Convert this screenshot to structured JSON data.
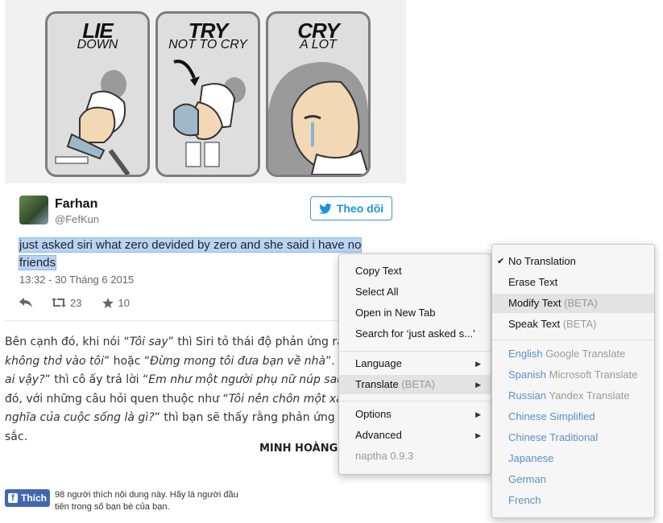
{
  "comic": {
    "panels": [
      {
        "line1": "LIE",
        "line2": "DOWN"
      },
      {
        "line1": "TRY",
        "line2": "NOT TO CRY"
      },
      {
        "line1": "CRY",
        "line2": "A LOT"
      }
    ]
  },
  "tweet": {
    "name": "Farhan",
    "handle": "@FefKun",
    "follow_label": "Theo dõi",
    "text": "just asked siri what zero devided by zero and she said i have no friends",
    "timestamp": "13:32 - 30 Tháng 6 2015",
    "retweets": "23",
    "likes": "10"
  },
  "article": {
    "lines": [
      [
        "Bên cạnh đó, khi nói “",
        "Tôi say",
        "” thì Siri tỏ thái độ phản ứng rất qu"
      ],
      [
        "",
        "không thở vào tôi",
        "” hoặc “",
        "Đừng mong tôi đưa bạn về nhà",
        "”. Đặc l"
      ],
      [
        "",
        "ai vậy?",
        "” thì cô ấy trả lời “",
        "Em như một người phụ nữ núp sau tr"
      ],
      [
        "đó, với những câu hỏi quen thuộc như “",
        "Tôi nên chôn một xác"
      ],
      [
        "",
        "nghĩa của cuộc sống là gì?",
        "” thì bạn sẽ thấy rằng phản ứng của"
      ],
      [
        "sắc."
      ]
    ],
    "author": "MINH HOÀNG"
  },
  "facebook": {
    "like_label": "Thích",
    "like_text": "98 người thích nội dung này. Hãy là người đầu tiên trong số bạn bè của bạn."
  },
  "context_menu": {
    "copy_text": "Copy Text",
    "select_all": "Select All",
    "open_new_tab": "Open in New Tab",
    "search_for": "Search for ‘just asked s...’",
    "language": "Language",
    "translate": "Translate",
    "translate_beta": "(BETA)",
    "options": "Options",
    "advanced": "Advanced",
    "version": "naptha 0.9.3"
  },
  "translate_menu": {
    "no_translation": "No Translation",
    "erase_text": "Erase Text",
    "modify_text": "Modify Text",
    "modify_beta": "(BETA)",
    "speak_text": "Speak Text",
    "speak_beta": "(BETA)",
    "english": "English",
    "english_provider": "Google Translate",
    "spanish": "Spanish",
    "spanish_provider": "Microsoft Translate",
    "russian": "Russian",
    "russian_provider": "Yandex Translate",
    "chinese_simplified": "Chinese Simplified",
    "chinese_traditional": "Chinese Traditional",
    "japanese": "Japanese",
    "german": "German",
    "french": "French"
  },
  "colors": {
    "twitter_blue": "#1b95e0",
    "selection": "#b8d4f5",
    "facebook_blue": "#4267b2",
    "language_blue": "#5b8fc9"
  }
}
